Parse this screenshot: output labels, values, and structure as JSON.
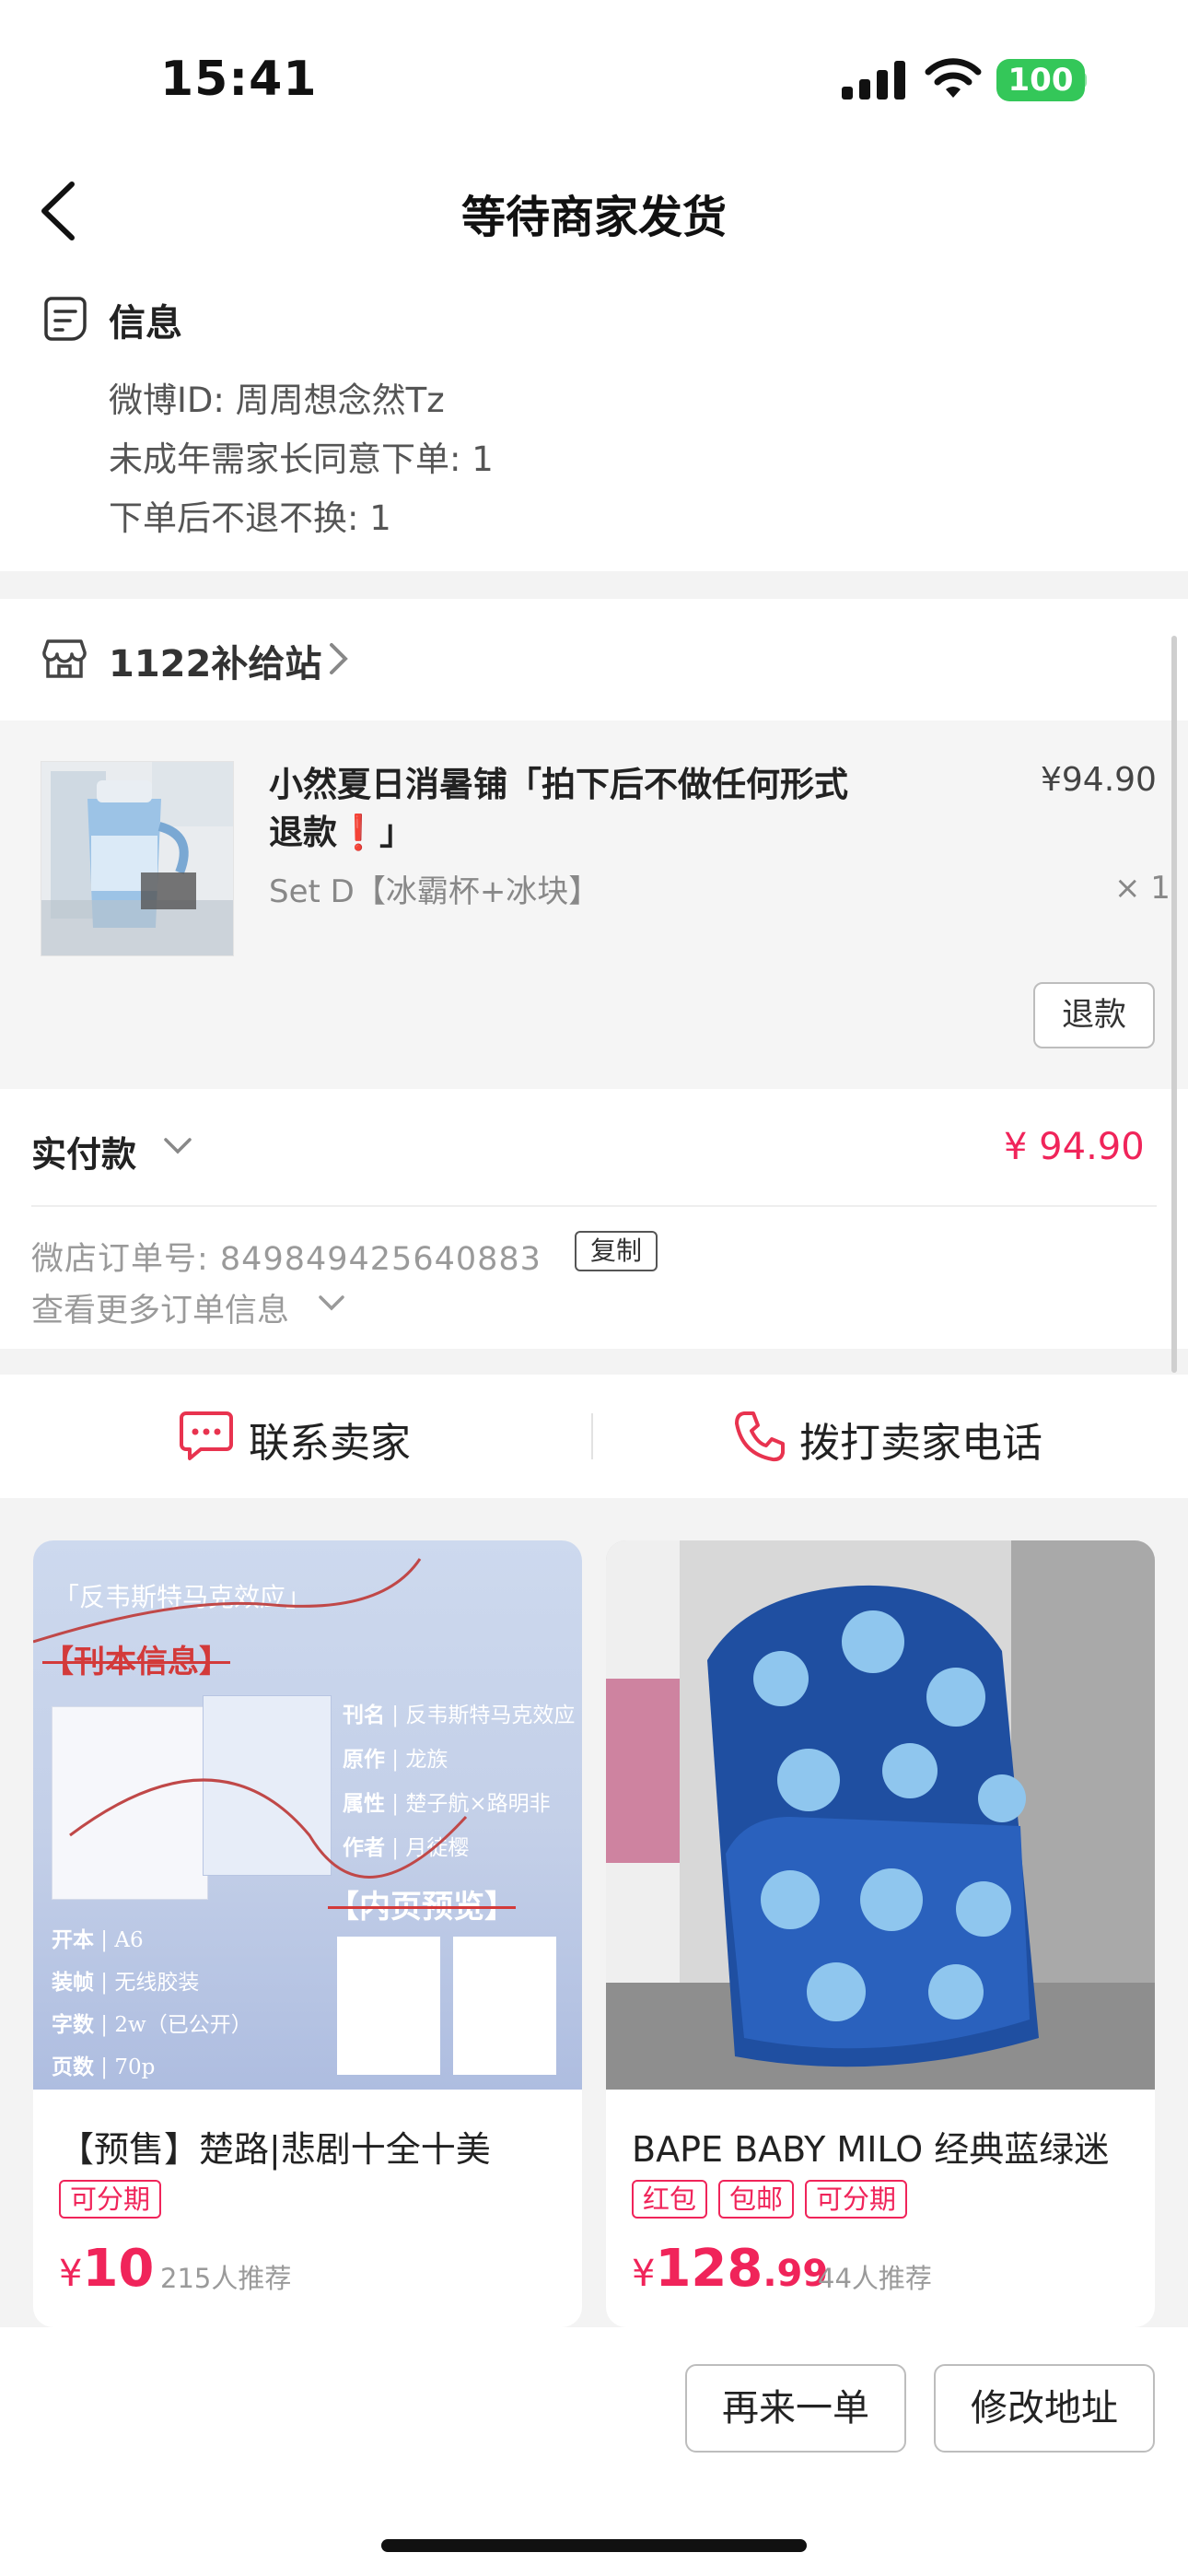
{
  "status_bar": {
    "time": "15:41",
    "battery": "100"
  },
  "nav": {
    "title": "等待商家发货"
  },
  "info": {
    "title": "信息",
    "lines": [
      "微博ID: 周周想念然Tz",
      "未成年需家长同意下单: 1",
      "下单后不退不换: 1"
    ]
  },
  "shop": {
    "name": "1122补给站"
  },
  "product": {
    "title": "小然夏日消暑铺「拍下后不做任何形式退款❗」",
    "spec": "Set D【冰霸杯+冰块】",
    "price": "¥94.90",
    "qty": "× 1",
    "refund_label": "退款"
  },
  "payment": {
    "label": "实付款",
    "amount": "¥ 94.90",
    "order_no": "微店订单号: 849849425640883",
    "copy_label": "复制",
    "more_label": "查看更多订单信息"
  },
  "contact": {
    "seller_label": "联系卖家",
    "call_label": "拨打卖家电话"
  },
  "recommend": [
    {
      "title": "【预售】楚路|悲剧十全十美",
      "tags": [
        "可分期"
      ],
      "currency": "¥",
      "price_int": "10",
      "price_dec": "",
      "recommend_text": "215人推荐",
      "image": {
        "heading": "「反韦斯特马克效应」",
        "section1": "【刊本信息】",
        "section2": "【内页预览】",
        "fields": [
          {
            "k": "刊名",
            "v": "反韦斯特马克效应"
          },
          {
            "k": "原作",
            "v": "龙族"
          },
          {
            "k": "属性",
            "v": "楚子航×路明非"
          },
          {
            "k": "作者",
            "v": "月徒樱"
          }
        ],
        "specs": [
          {
            "k": "开本",
            "v": "A6"
          },
          {
            "k": "装帧",
            "v": "无线胶装"
          },
          {
            "k": "字数",
            "v": "2w（已公开）"
          },
          {
            "k": "页数",
            "v": "70p"
          }
        ]
      }
    },
    {
      "title": "BAPE BABY MILO 经典蓝绿迷",
      "tags": [
        "红包",
        "包邮",
        "可分期"
      ],
      "currency": "¥",
      "price_int": "128",
      "price_dec": ".99",
      "recommend_text": "44人推荐"
    }
  ],
  "bottom": {
    "reorder_label": "再来一单",
    "change_address_label": "修改地址"
  },
  "colors": {
    "accent": "#f0245a",
    "battery": "#34c759",
    "page_bg": "#f3f3f3"
  }
}
